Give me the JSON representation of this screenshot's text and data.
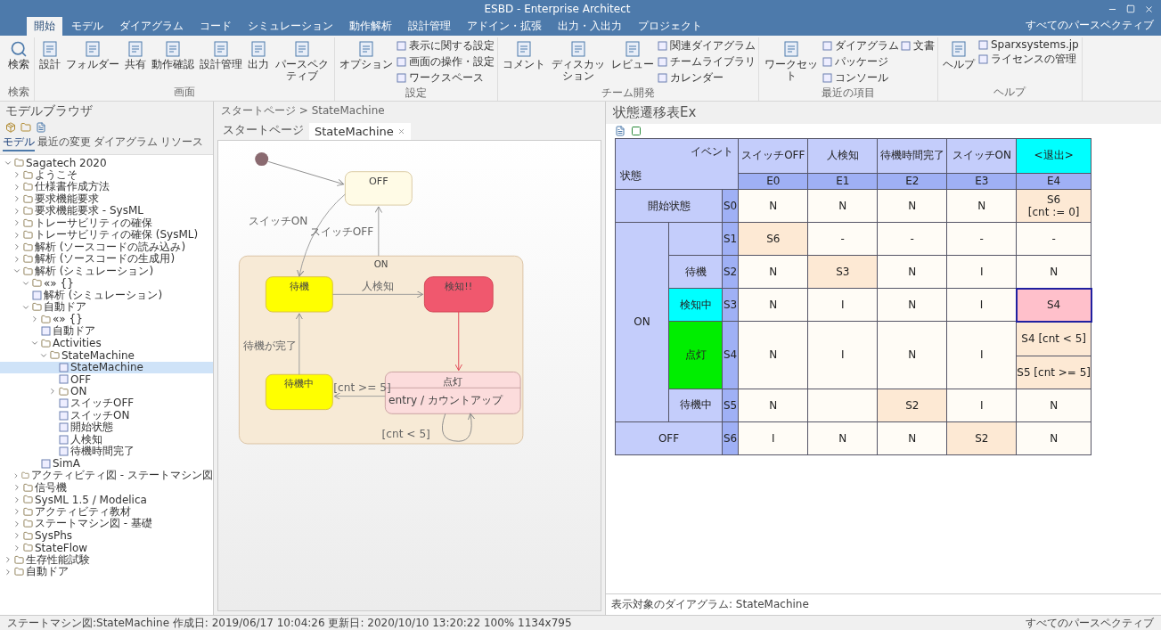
{
  "window": {
    "title": "ESBD - Enterprise Architect",
    "perspective": "すべてのパースペクティブ"
  },
  "ribbon": {
    "tabs": [
      {
        "label": "開始",
        "selected": true
      },
      {
        "label": "モデル",
        "selected": false
      },
      {
        "label": "ダイアグラム",
        "selected": false
      },
      {
        "label": "コード",
        "selected": false
      },
      {
        "label": "シミュレーション",
        "selected": false
      },
      {
        "label": "動作解析",
        "selected": false
      },
      {
        "label": "設計管理",
        "selected": false
      },
      {
        "label": "アドイン・拡張",
        "selected": false
      },
      {
        "label": "出力・入出力",
        "selected": false
      },
      {
        "label": "プロジェクト",
        "selected": false
      }
    ],
    "groups": [
      {
        "label": "検索",
        "items": [
          {
            "label": "検索",
            "kind": "large"
          }
        ]
      },
      {
        "label": "画面",
        "items": [
          {
            "label": "設計",
            "kind": "large"
          },
          {
            "label": "フォルダー",
            "kind": "large"
          },
          {
            "label": "共有",
            "kind": "large"
          },
          {
            "label": "動作確認",
            "kind": "large"
          },
          {
            "label": "設計管理",
            "kind": "large"
          },
          {
            "label": "出力",
            "kind": "large"
          },
          {
            "label": "パースペクティブ",
            "kind": "large"
          }
        ]
      },
      {
        "label": "設定",
        "items": [
          {
            "label": "オプション",
            "kind": "large"
          },
          {
            "label": "表示に関する設定",
            "kind": "small"
          },
          {
            "label": "画面の操作・設定",
            "kind": "small"
          },
          {
            "label": "ワークスペース",
            "kind": "small"
          }
        ]
      },
      {
        "label": "チーム開発",
        "items": [
          {
            "label": "コメント",
            "kind": "large"
          },
          {
            "label": "ディスカッション",
            "kind": "large"
          },
          {
            "label": "レビュー",
            "kind": "large"
          },
          {
            "label": "関連ダイアグラム",
            "kind": "small"
          },
          {
            "label": "チームライブラリ",
            "kind": "small"
          },
          {
            "label": "カレンダー",
            "kind": "small"
          }
        ]
      },
      {
        "label": "最近の項目",
        "items": [
          {
            "label": "ワークセット",
            "kind": "large"
          },
          {
            "label": "ダイアグラム",
            "kind": "small"
          },
          {
            "label": "パッケージ",
            "kind": "small"
          },
          {
            "label": "コンソール",
            "kind": "small"
          },
          {
            "label": "文書",
            "kind": "small"
          }
        ]
      },
      {
        "label": "ヘルプ",
        "items": [
          {
            "label": "ヘルプ",
            "kind": "large"
          },
          {
            "label": "Sparxsystems.jp",
            "kind": "small"
          },
          {
            "label": "ライセンスの管理",
            "kind": "small"
          }
        ]
      }
    ]
  },
  "browser": {
    "title": "モデルブラウザ",
    "tabs": [
      {
        "label": "モデル",
        "selected": true
      },
      {
        "label": "最近の変更",
        "selected": false
      },
      {
        "label": "ダイアグラム",
        "selected": false
      },
      {
        "label": "リソース",
        "selected": false
      }
    ],
    "tree": [
      {
        "label": "Sagatech 2020",
        "expanded": true,
        "selected": false,
        "children": [
          {
            "label": "ようこそ",
            "expanded": false,
            "selected": false
          },
          {
            "label": "仕様書作成方法",
            "expanded": false,
            "selected": false
          },
          {
            "label": "要求機能要求",
            "expanded": false,
            "selected": false
          },
          {
            "label": "要求機能要求 - SysML",
            "expanded": false,
            "selected": false
          },
          {
            "label": "トレーサビリティの確保",
            "expanded": false,
            "selected": false
          },
          {
            "label": "トレーサビリティの確保 (SysML)",
            "expanded": false,
            "selected": false
          },
          {
            "label": "解析 (ソースコードの読み込み)",
            "expanded": false,
            "selected": false
          },
          {
            "label": "解析 (ソースコードの生成用)",
            "expanded": false,
            "selected": false
          },
          {
            "label": "解析 (シミュレーション)",
            "expanded": true,
            "selected": false,
            "children": [
              {
                "label": "«» {}",
                "expanded": true,
                "selected": false
              },
              {
                "label": "解析 (シミュレーション)",
                "selected": false
              },
              {
                "label": "自動ドア",
                "expanded": true,
                "selected": false,
                "children": [
                  {
                    "label": "«» {}",
                    "expanded": false,
                    "selected": false
                  },
                  {
                    "label": "自動ドア",
                    "selected": false
                  },
                  {
                    "label": "Activities",
                    "expanded": true,
                    "selected": false,
                    "children": [
                      {
                        "label": "StateMachine",
                        "expanded": true,
                        "selected": false,
                        "children": [
                          {
                            "label": "StateMachine",
                            "selected": true
                          },
                          {
                            "label": "OFF",
                            "selected": false
                          },
                          {
                            "label": "ON",
                            "expanded": false,
                            "selected": false
                          },
                          {
                            "label": "スイッチOFF",
                            "selected": false
                          },
                          {
                            "label": "スイッチON",
                            "selected": false
                          },
                          {
                            "label": "開始状態",
                            "selected": false
                          },
                          {
                            "label": "人検知",
                            "selected": false
                          },
                          {
                            "label": "待機時間完了",
                            "selected": false
                          }
                        ]
                      }
                    ]
                  },
                  {
                    "label": "SimA",
                    "selected": false
                  }
                ]
              }
            ]
          },
          {
            "label": "アクティビティ図 - ステートマシン図",
            "expanded": false,
            "selected": false
          },
          {
            "label": "信号機",
            "expanded": false,
            "selected": false
          },
          {
            "label": "SysML 1.5 / Modelica",
            "expanded": false,
            "selected": false
          },
          {
            "label": "アクティビティ教材",
            "expanded": false,
            "selected": false
          },
          {
            "label": "ステートマシン図 - 基礎",
            "expanded": false,
            "selected": false
          },
          {
            "label": "SysPhs",
            "expanded": false,
            "selected": false
          },
          {
            "label": "StateFlow",
            "expanded": false,
            "selected": false
          }
        ]
      },
      {
        "label": "生存性能試験",
        "expanded": false,
        "selected": false
      },
      {
        "label": "自動ドア",
        "expanded": false,
        "selected": false
      }
    ]
  },
  "diagram": {
    "breadcrumb": "スタートページ > StateMachine",
    "tabs": [
      {
        "label": "スタートページ",
        "selected": false
      },
      {
        "label": "StateMachine",
        "selected": true
      }
    ],
    "states": [
      {
        "name": "OFF",
        "color": "#fffbe6"
      },
      {
        "name": "ON",
        "color": "#f7ead6"
      },
      {
        "name": "待機",
        "color": "#ffff00"
      },
      {
        "name": "検知!!",
        "color": "#f0586e"
      },
      {
        "name": "待機中",
        "color": "#ffff00"
      },
      {
        "name": "点灯",
        "color": "#fcdcdc",
        "entry": "entry / カウントアップ"
      }
    ],
    "transitions": [
      {
        "label": "スイッチON"
      },
      {
        "label": "スイッチOFF"
      },
      {
        "label": "人検知"
      },
      {
        "label": "待機が完了"
      },
      {
        "label": "[cnt >= 5]"
      },
      {
        "label": "[cnt < 5]"
      }
    ]
  },
  "table": {
    "title": "状態遷移表Ex",
    "corner_event": "イベント",
    "corner_state": "状態",
    "columns": [
      {
        "label": "スイッチOFF",
        "code": "E0",
        "highlighted": false
      },
      {
        "label": "人検知",
        "code": "E1",
        "highlighted": false
      },
      {
        "label": "待機時間完了",
        "code": "E2",
        "highlighted": false
      },
      {
        "label": "スイッチON",
        "code": "E3",
        "highlighted": false
      },
      {
        "label": "<退出>",
        "code": "E4",
        "highlighted": true
      }
    ],
    "rows": [
      {
        "kind": "row",
        "label": "開始状態",
        "code": "S0",
        "cells": [
          {
            "text": "N",
            "kind": "plain",
            "selected": false
          },
          {
            "text": "N",
            "kind": "plain",
            "selected": false
          },
          {
            "text": "N",
            "kind": "plain",
            "selected": false
          },
          {
            "text": "N",
            "kind": "plain",
            "selected": false
          },
          {
            "text": "S6\n[cnt := 0]",
            "kind": "changed",
            "selected": false
          }
        ]
      },
      {
        "kind": "group",
        "label": "ON",
        "rows": [
          {
            "code": "S1",
            "cells": [
              {
                "text": "S6",
                "kind": "changed",
                "selected": false
              },
              {
                "text": "-",
                "kind": "plain",
                "selected": false
              },
              {
                "text": "-",
                "kind": "plain",
                "selected": false
              },
              {
                "text": "-",
                "kind": "plain",
                "selected": false
              },
              {
                "text": "-",
                "kind": "plain",
                "selected": false
              }
            ]
          },
          {
            "label": "待機",
            "code": "S2",
            "cells": [
              {
                "text": "N",
                "kind": "plain",
                "selected": false
              },
              {
                "text": "S3",
                "kind": "changed",
                "selected": false
              },
              {
                "text": "N",
                "kind": "plain",
                "selected": false
              },
              {
                "text": "I",
                "kind": "plain",
                "selected": false
              },
              {
                "text": "N",
                "kind": "plain",
                "selected": false
              }
            ]
          },
          {
            "label": "検知中",
            "code": "S3",
            "color": "#00ffff",
            "cells": [
              {
                "text": "N",
                "kind": "plain",
                "selected": false
              },
              {
                "text": "I",
                "kind": "plain",
                "selected": false
              },
              {
                "text": "N",
                "kind": "plain",
                "selected": false
              },
              {
                "text": "I",
                "kind": "plain",
                "selected": false
              },
              {
                "text": "S4",
                "kind": "plain",
                "selected": true
              }
            ]
          },
          {
            "label": "点灯",
            "code": "S4",
            "color": "#00ee00",
            "cells": [
              {
                "text": "N",
                "kind": "plain",
                "selected": false
              },
              {
                "text": "I",
                "kind": "plain",
                "selected": false
              },
              {
                "text": "N",
                "kind": "plain",
                "selected": false
              },
              {
                "text": "I",
                "kind": "plain",
                "selected": false
              },
              {
                "parts": [
                  "S4 [cnt < 5]",
                  "S5 [cnt >= 5]"
                ],
                "kind": "changed",
                "selected": false
              }
            ]
          },
          {
            "label": "待機中",
            "code": "S5",
            "cells": [
              {
                "text": "N",
                "kind": "plain",
                "selected": false
              },
              {
                "kind": "plain",
                "selected": false
              },
              {
                "text": "S2",
                "kind": "changed",
                "selected": false
              },
              {
                "text": "I",
                "kind": "plain",
                "selected": false
              },
              {
                "text": "N",
                "kind": "plain",
                "selected": false
              }
            ]
          }
        ]
      },
      {
        "kind": "row",
        "label": "OFF",
        "code": "S6",
        "cells": [
          {
            "text": "I",
            "kind": "plain",
            "selected": false
          },
          {
            "text": "N",
            "kind": "plain",
            "selected": false
          },
          {
            "text": "N",
            "kind": "plain",
            "selected": false
          },
          {
            "text": "S2",
            "kind": "changed",
            "selected": false
          },
          {
            "text": "N",
            "kind": "plain",
            "selected": false
          }
        ]
      }
    ],
    "footer": "表示対象のダイアグラム: StateMachine"
  },
  "status_bar": {
    "text": "ステートマシン図:StateMachine  作成日: 2019/06/17 10:04:26  更新日: 2020/10/10 13:20:22  100%  1134x795",
    "perspective": "すべてのパースペクティブ"
  }
}
